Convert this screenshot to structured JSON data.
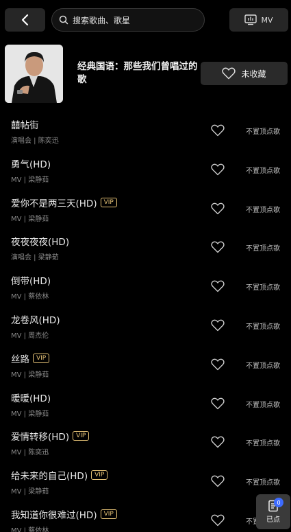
{
  "topbar": {
    "search_placeholder": "搜索歌曲、歌星",
    "mv_label": "MV"
  },
  "album": {
    "title": "经典国语：那些我们曾唱过的歌",
    "favorite_label": "未收藏"
  },
  "songs": [
    {
      "title": "囍帖街",
      "meta": "演唱会 | 陈奕迅",
      "vip": false,
      "pin_label": "不置顶点歌"
    },
    {
      "title": "勇气(HD)",
      "meta": "MV | 梁静茹",
      "vip": false,
      "pin_label": "不置顶点歌"
    },
    {
      "title": "爱你不是两三天(HD)",
      "meta": "MV | 梁静茹",
      "vip": true,
      "pin_label": "不置顶点歌"
    },
    {
      "title": "夜夜夜夜(HD)",
      "meta": "演唱会 | 梁静茹",
      "vip": false,
      "pin_label": "不置顶点歌"
    },
    {
      "title": "倒带(HD)",
      "meta": "MV | 蔡依林",
      "vip": false,
      "pin_label": "不置顶点歌"
    },
    {
      "title": "龙卷风(HD)",
      "meta": "MV | 周杰伦",
      "vip": false,
      "pin_label": "不置顶点歌"
    },
    {
      "title": "丝路",
      "meta": "MV | 梁静茹",
      "vip": true,
      "pin_label": "不置顶点歌"
    },
    {
      "title": "暖暖(HD)",
      "meta": "MV | 梁静茹",
      "vip": false,
      "pin_label": "不置顶点歌"
    },
    {
      "title": "爱情转移(HD)",
      "meta": "MV | 陈奕迅",
      "vip": true,
      "pin_label": "不置顶点歌"
    },
    {
      "title": "给未来的自己(HD)",
      "meta": "MV | 梁静茹",
      "vip": true,
      "pin_label": "不置顶点歌"
    },
    {
      "title": "我知道你很难过(HD)",
      "meta": "MV | 蔡依林",
      "vip": true,
      "pin_label": "不置顶点歌"
    }
  ],
  "vip_label": "VIP",
  "queue": {
    "label": "已点",
    "count": "0"
  },
  "colors": {
    "background": "#000000",
    "vip_gold": "#e8c477",
    "badge_blue": "#3d6bff"
  },
  "icons": [
    "back-arrow-icon",
    "search-icon",
    "tv-icon",
    "heart-icon",
    "queue-list-icon"
  ]
}
